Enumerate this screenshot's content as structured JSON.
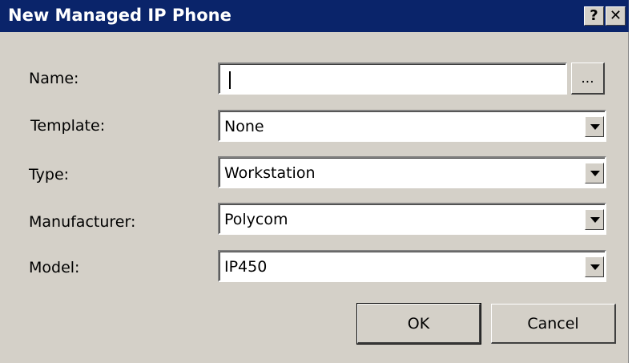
{
  "window": {
    "title": "New Managed IP Phone",
    "help_label": "?",
    "close_label": "✕"
  },
  "form": {
    "name": {
      "label": "Name:",
      "value": "",
      "browse_label": "..."
    },
    "template": {
      "label": "Template:",
      "value": "None"
    },
    "type": {
      "label": "Type:",
      "value": "Workstation"
    },
    "manufacturer": {
      "label": "Manufacturer:",
      "value": "Polycom"
    },
    "model": {
      "label": "Model:",
      "value": "IP450"
    }
  },
  "buttons": {
    "ok": "OK",
    "cancel": "Cancel"
  },
  "colors": {
    "titlebar": "#0a246a",
    "dialog_face": "#d4d0c8"
  },
  "icons": {
    "help": "help-icon",
    "close": "close-icon",
    "dropdown": "chevron-down-icon"
  }
}
